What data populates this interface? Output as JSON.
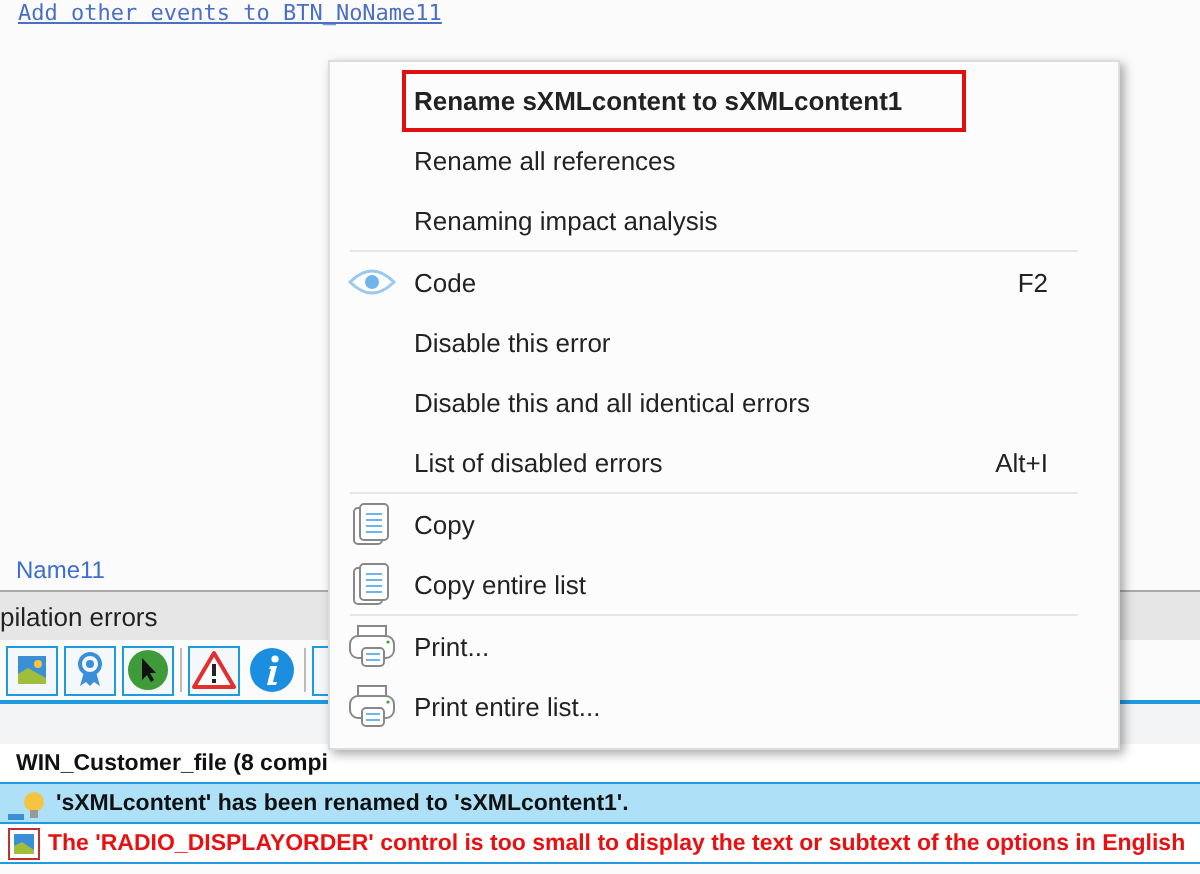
{
  "editor": {
    "link": "Add other events to BTN_NoName11",
    "tab": "Name11"
  },
  "pane": {
    "title": "pilation errors",
    "toolbar": [
      {
        "kind": "picture"
      },
      {
        "kind": "award"
      },
      {
        "kind": "pointer"
      },
      {
        "kind": "separator"
      },
      {
        "kind": "warning"
      },
      {
        "kind": "info"
      },
      {
        "kind": "separator"
      },
      {
        "kind": "blank"
      }
    ],
    "rows": [
      {
        "kind": "group",
        "text": "WIN_Customer_file (8 compi",
        "selected": false
      },
      {
        "kind": "info",
        "text": "'sXMLcontent' has been renamed to 'sXMLcontent1'.",
        "selected": true
      },
      {
        "kind": "error",
        "text": "The 'RADIO_DISPLAYORDER' control is too small to display the text or subtext of the options in English",
        "selected": false
      }
    ]
  },
  "context_menu": {
    "items": [
      {
        "kind": "plain",
        "label": "Rename sXMLcontent to sXMLcontent1",
        "selected": true
      },
      {
        "kind": "plain",
        "label": "Rename all references",
        "selected": false
      },
      {
        "kind": "plain",
        "label": "Renaming impact analysis",
        "selected": false
      },
      {
        "kind": "separator"
      },
      {
        "kind": "view",
        "label": "Code",
        "shortcut": "F2",
        "selected": false
      },
      {
        "kind": "plain",
        "label": "Disable this error",
        "selected": false
      },
      {
        "kind": "plain",
        "label": "Disable this and all identical errors",
        "selected": false
      },
      {
        "kind": "plain",
        "label": "List of disabled errors",
        "shortcut": "Alt+I",
        "selected": false
      },
      {
        "kind": "separator"
      },
      {
        "kind": "copy",
        "label": "Copy",
        "selected": false
      },
      {
        "kind": "copy",
        "label": "Copy entire list",
        "selected": false
      },
      {
        "kind": "separator"
      },
      {
        "kind": "print",
        "label": "Print...",
        "selected": false
      },
      {
        "kind": "print",
        "label": "Print entire list...",
        "selected": false
      }
    ]
  }
}
